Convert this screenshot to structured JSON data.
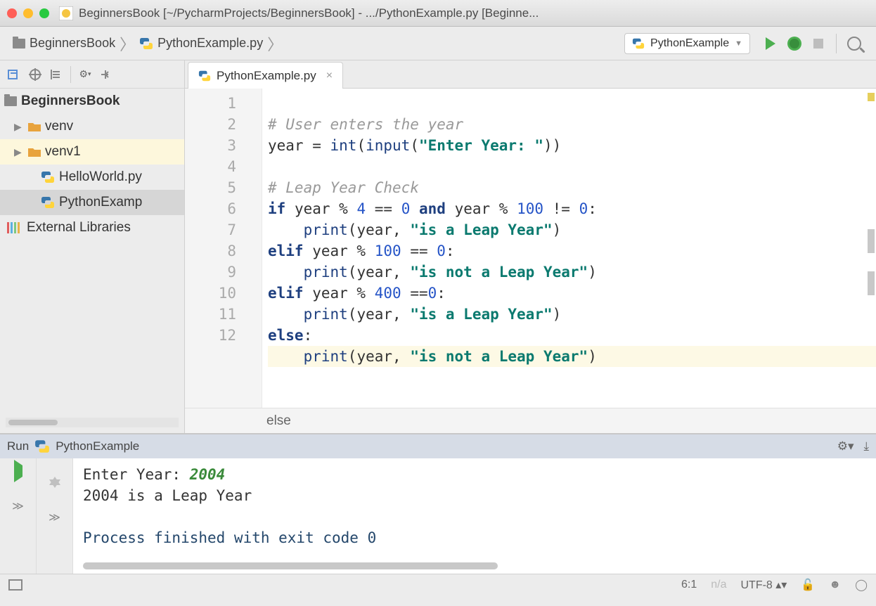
{
  "titlebar": {
    "text": "BeginnersBook [~/PycharmProjects/BeginnersBook] - .../PythonExample.py [Beginne..."
  },
  "breadcrumb": {
    "root": "BeginnersBook",
    "file": "PythonExample.py"
  },
  "runConfig": "PythonExample",
  "tree": {
    "project": "BeginnersBook",
    "items": [
      {
        "label": "venv",
        "icon": "folder"
      },
      {
        "label": "venv1",
        "icon": "folder"
      },
      {
        "label": "HelloWorld.py",
        "icon": "py"
      },
      {
        "label": "PythonExamp",
        "icon": "py"
      }
    ],
    "external": "External Libraries"
  },
  "tab": {
    "name": "PythonExample.py"
  },
  "code": {
    "lines": [
      "1",
      "2",
      "3",
      "4",
      "5",
      "6",
      "7",
      "8",
      "9",
      "10",
      "11",
      "12"
    ],
    "l1_comment": "# User enters the year",
    "l2_a": "year = ",
    "l2_fn": "int",
    "l2_b": "(",
    "l2_fn2": "input",
    "l2_c": "(",
    "l2_str": "\"Enter Year: \"",
    "l2_d": "))",
    "l4_comment": "# Leap Year Check",
    "l5_if": "if",
    "l5_a": " year % ",
    "l5_n4": "4",
    "l5_b": " == ",
    "l5_n0": "0",
    "l5_and": " and ",
    "l5_c": "year % ",
    "l5_n100": "100",
    "l5_d": " != ",
    "l5_n0b": "0",
    "l5_e": ":",
    "l6_a": "    ",
    "l6_fn": "print",
    "l6_b": "(year, ",
    "l6_str": "\"is a Leap Year\"",
    "l6_c": ")",
    "l7_elif": "elif",
    "l7_a": " year % ",
    "l7_n100": "100",
    "l7_b": " == ",
    "l7_n0": "0",
    "l7_c": ":",
    "l8_a": "    ",
    "l8_fn": "print",
    "l8_b": "(year, ",
    "l8_str": "\"is not a Leap Year\"",
    "l8_c": ")",
    "l9_elif": "elif",
    "l9_a": " year % ",
    "l9_n400": "400",
    "l9_b": " ==",
    "l9_n0": "0",
    "l9_c": ":",
    "l10_a": "    ",
    "l10_fn": "print",
    "l10_b": "(year, ",
    "l10_str": "\"is a Leap Year\"",
    "l10_c": ")",
    "l11_else": "else",
    "l11_a": ":",
    "l12_a": "    ",
    "l12_fn": "print",
    "l12_b": "(year, ",
    "l12_str": "\"is not a Leap Year\"",
    "l12_c": ")"
  },
  "crumb": "else",
  "run": {
    "label": "Run",
    "config": "PythonExample",
    "console": {
      "l1_a": "Enter Year: ",
      "l1_in": "2004",
      "l2": "2004 is a Leap Year",
      "l3": "Process finished with exit code 0"
    }
  },
  "status": {
    "pos": "6:1",
    "na": "n/a",
    "enc": "UTF-8"
  }
}
